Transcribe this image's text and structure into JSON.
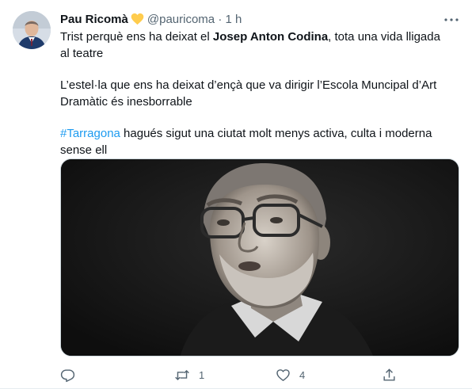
{
  "tweet": {
    "author_name": "Pau Ricomà",
    "verified_emoji": "heart-yellow",
    "handle": "@pauricoma",
    "separator": "·",
    "time": "1 h",
    "line1_before": "Trist perquè ens ha deixat el ",
    "line1_bold": "Josep Anton Codina",
    "line1_after": ", tota una vida lligada al teatre",
    "paragraph2": "L’estel·la que ens ha deixat d’ençà que va dirigir l’Escola Muncipal d’Art Dramàtic és inesborrable",
    "hashtag": "#Tarragona",
    "paragraph3_after": " hagués sigut una ciutat molt menys activa, culta i moderna sense ell"
  },
  "actions": {
    "reply_count": "",
    "retweet_count": "1",
    "like_count": "4"
  },
  "colors": {
    "accent": "#1d9bf0",
    "muted": "#536471",
    "heart": "#ffcc4d"
  }
}
